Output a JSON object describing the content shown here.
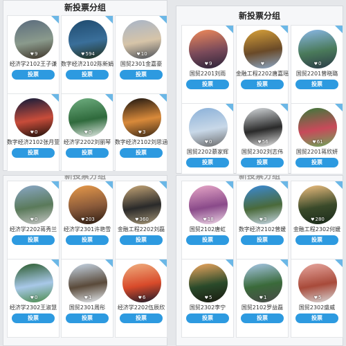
{
  "panels": [
    {
      "title": "新投票分组",
      "cards": [
        {
          "name": "经济学2102王子谦",
          "likes": "9",
          "button": "投票",
          "colors": [
            "#5a6b7d",
            "#8a9a8c",
            "#3d3328"
          ]
        },
        {
          "name": "数字经济2102陈新娟",
          "likes": "594",
          "button": "投票",
          "colors": [
            "#1e4a6e",
            "#3a6f9a",
            "#22301c"
          ]
        },
        {
          "name": "国贸2301金嘉豪",
          "likes": "10",
          "button": "投票",
          "colors": [
            "#a8b5c8",
            "#d6c4a8",
            "#4a4f58"
          ]
        },
        {
          "name": "数字经济2102张月萱",
          "likes": "0",
          "button": "投票",
          "colors": [
            "#0c1a3a",
            "#c84c3a",
            "#1a0f0a"
          ]
        },
        {
          "name": "经济学2202刘丽琴",
          "likes": "0",
          "button": "投票",
          "colors": [
            "#6fae80",
            "#2f6a3c",
            "#e6ece8"
          ]
        },
        {
          "name": "数字经济2102刘思涵",
          "likes": "3",
          "button": "投票",
          "colors": [
            "#1a1410",
            "#d98a3a",
            "#3a2816"
          ]
        }
      ]
    },
    {
      "title": "新投票分组",
      "cards": [
        {
          "name": "国贸2201刘雨",
          "likes": "9",
          "button": "投票",
          "colors": [
            "#f08a5a",
            "#7a4a5a",
            "#2a2238"
          ]
        },
        {
          "name": "金融工程2202唐嘉瑶",
          "likes": "",
          "button": "投票",
          "colors": [
            "#d9a23a",
            "#6a4a28",
            "#8aa8c8"
          ]
        },
        {
          "name": "国贸2201曾晓璐",
          "likes": "0",
          "button": "投票",
          "colors": [
            "#8ab8e8",
            "#4a7a5a",
            "#2a3a48"
          ]
        },
        {
          "name": "国贸2202慕家辉",
          "likes": "0",
          "button": "投票",
          "colors": [
            "#8ab0d8",
            "#c8d8e8",
            "#6a6a6a"
          ]
        },
        {
          "name": "国贸2302刘志伟",
          "likes": "56",
          "button": "投票",
          "colors": [
            "#d8dcdf",
            "#2a2a2a",
            "#e8e8e8"
          ]
        },
        {
          "name": "国贸2201蒋欣妍",
          "likes": "61",
          "button": "投票",
          "colors": [
            "#3a7a3a",
            "#c84a5a",
            "#6aa85a"
          ]
        }
      ]
    },
    {
      "title": "新投票分组",
      "cards": [
        {
          "name": "经济学2202蒋秀兰",
          "likes": "0",
          "button": "投票",
          "colors": [
            "#8aa8c8",
            "#5a7a5a",
            "#c8c8c8"
          ]
        },
        {
          "name": "经济学2301许艳雪",
          "likes": "203",
          "button": "投票",
          "colors": [
            "#e89a4a",
            "#8a5a3a",
            "#2a1a10"
          ]
        },
        {
          "name": "金融工程2202刘磊",
          "likes": "360",
          "button": "投票",
          "colors": [
            "#c8a878",
            "#2a2a2a",
            "#a89878"
          ]
        },
        {
          "name": "经济学2302王淑慧",
          "likes": "0",
          "button": "投票",
          "colors": [
            "#2a5a2a",
            "#a8c8e8",
            "#4a8a4a"
          ]
        },
        {
          "name": "国贸2301周彤",
          "likes": "1",
          "button": "投票",
          "colors": [
            "#c8d8e8",
            "#5a4a3a",
            "#e8eef4"
          ]
        },
        {
          "name": "经济学2202伍辰欣",
          "likes": "6",
          "button": "投票",
          "colors": [
            "#f0b080",
            "#d84a2a",
            "#1a1a2a"
          ]
        }
      ]
    },
    {
      "title": "新投票分组",
      "cards": [
        {
          "name": "国贸2102唐虹",
          "likes": "18",
          "button": "投票",
          "colors": [
            "#e8a8c8",
            "#8a4a8a",
            "#f0d8e8"
          ]
        },
        {
          "name": "数字经济2102曾媛",
          "likes": "3",
          "button": "投票",
          "colors": [
            "#3a8ad8",
            "#4a6a3a",
            "#c8d8e8"
          ]
        },
        {
          "name": "金融工程2302何媛",
          "likes": "280",
          "button": "投票",
          "colors": [
            "#f0c080",
            "#3a4a2a",
            "#1a2a1a"
          ]
        },
        {
          "name": "国贸2302李宁",
          "likes": "5",
          "button": "投票",
          "colors": [
            "#f0a860",
            "#2a4a2a",
            "#1a1a10"
          ]
        },
        {
          "name": "国贸2102罗益磊",
          "likes": "1",
          "button": "投票",
          "colors": [
            "#a8c8e8",
            "#3a6a3a",
            "#4a4a4a"
          ]
        },
        {
          "name": "国贸2302盛威",
          "likes": "5",
          "button": "投票",
          "colors": [
            "#e8a8a0",
            "#a84a3a",
            "#d8d8d8"
          ]
        }
      ]
    }
  ]
}
